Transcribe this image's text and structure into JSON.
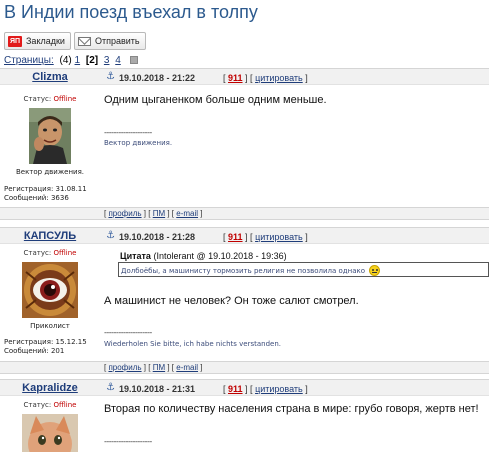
{
  "page": {
    "title": "В Индии поезд въехал в толпу"
  },
  "toolbar": {
    "bookmarks_label": "Закладки",
    "bookmarks_logo": "ЯП",
    "send_label": "Отправить"
  },
  "pagination": {
    "label": "Страницы:",
    "count": "(4)",
    "pages": [
      "1",
      "[2]",
      "3",
      "4"
    ]
  },
  "posts": [
    {
      "nick": "Clizma",
      "date": "19.10.2018 - 21:22",
      "number": "911",
      "quote_label": "цитировать",
      "status_label": "Статус:",
      "status_value": "Offline",
      "rank": "Вектор движения.",
      "reg_label": "Регистрация:",
      "reg_value": "31.08.11",
      "msgs_label": "Сообщений:",
      "msgs_value": "3636",
      "text": "Одним цыганенком больше одним меньше.",
      "sig_line": "--------------------",
      "signature": "Вектор движения."
    },
    {
      "nick": "КАПСУЛЬ",
      "date": "19.10.2018 - 21:28",
      "number": "911",
      "quote_label": "цитировать",
      "status_label": "Статус:",
      "status_value": "Offline",
      "rank": "Приколист",
      "reg_label": "Регистрация:",
      "reg_value": "15.12.15",
      "msgs_label": "Сообщений:",
      "msgs_value": "201",
      "quote_title": "Цитата",
      "quote_author": "(Intolerant @ 19.10.2018 - 19:36)",
      "quote_text": "Долбоёбы, а машинисту тормозить религия не позволила однако",
      "text": "А машинист не человек? Он тоже салют смотрел.",
      "sig_line": "--------------------",
      "signature": "Wiederholen Sie bitte, ich habe nichts verstanden."
    },
    {
      "nick": "Kapralidze",
      "date": "19.10.2018 - 21:31",
      "number": "911",
      "quote_label": "цитировать",
      "status_label": "Статус:",
      "status_value": "Offline",
      "text": "Вторая по количеству населения страна в мире: грубо говоря, жертв нет!",
      "sig_line": "--------------------"
    }
  ],
  "footer_links": {
    "profile": "профиль",
    "pm": "ПМ",
    "email": "e-mail"
  },
  "colors": {
    "title": "#2c5a8e",
    "link": "#1f3d7a",
    "offline": "#c00000",
    "header_bg": "#f1f1f1"
  }
}
